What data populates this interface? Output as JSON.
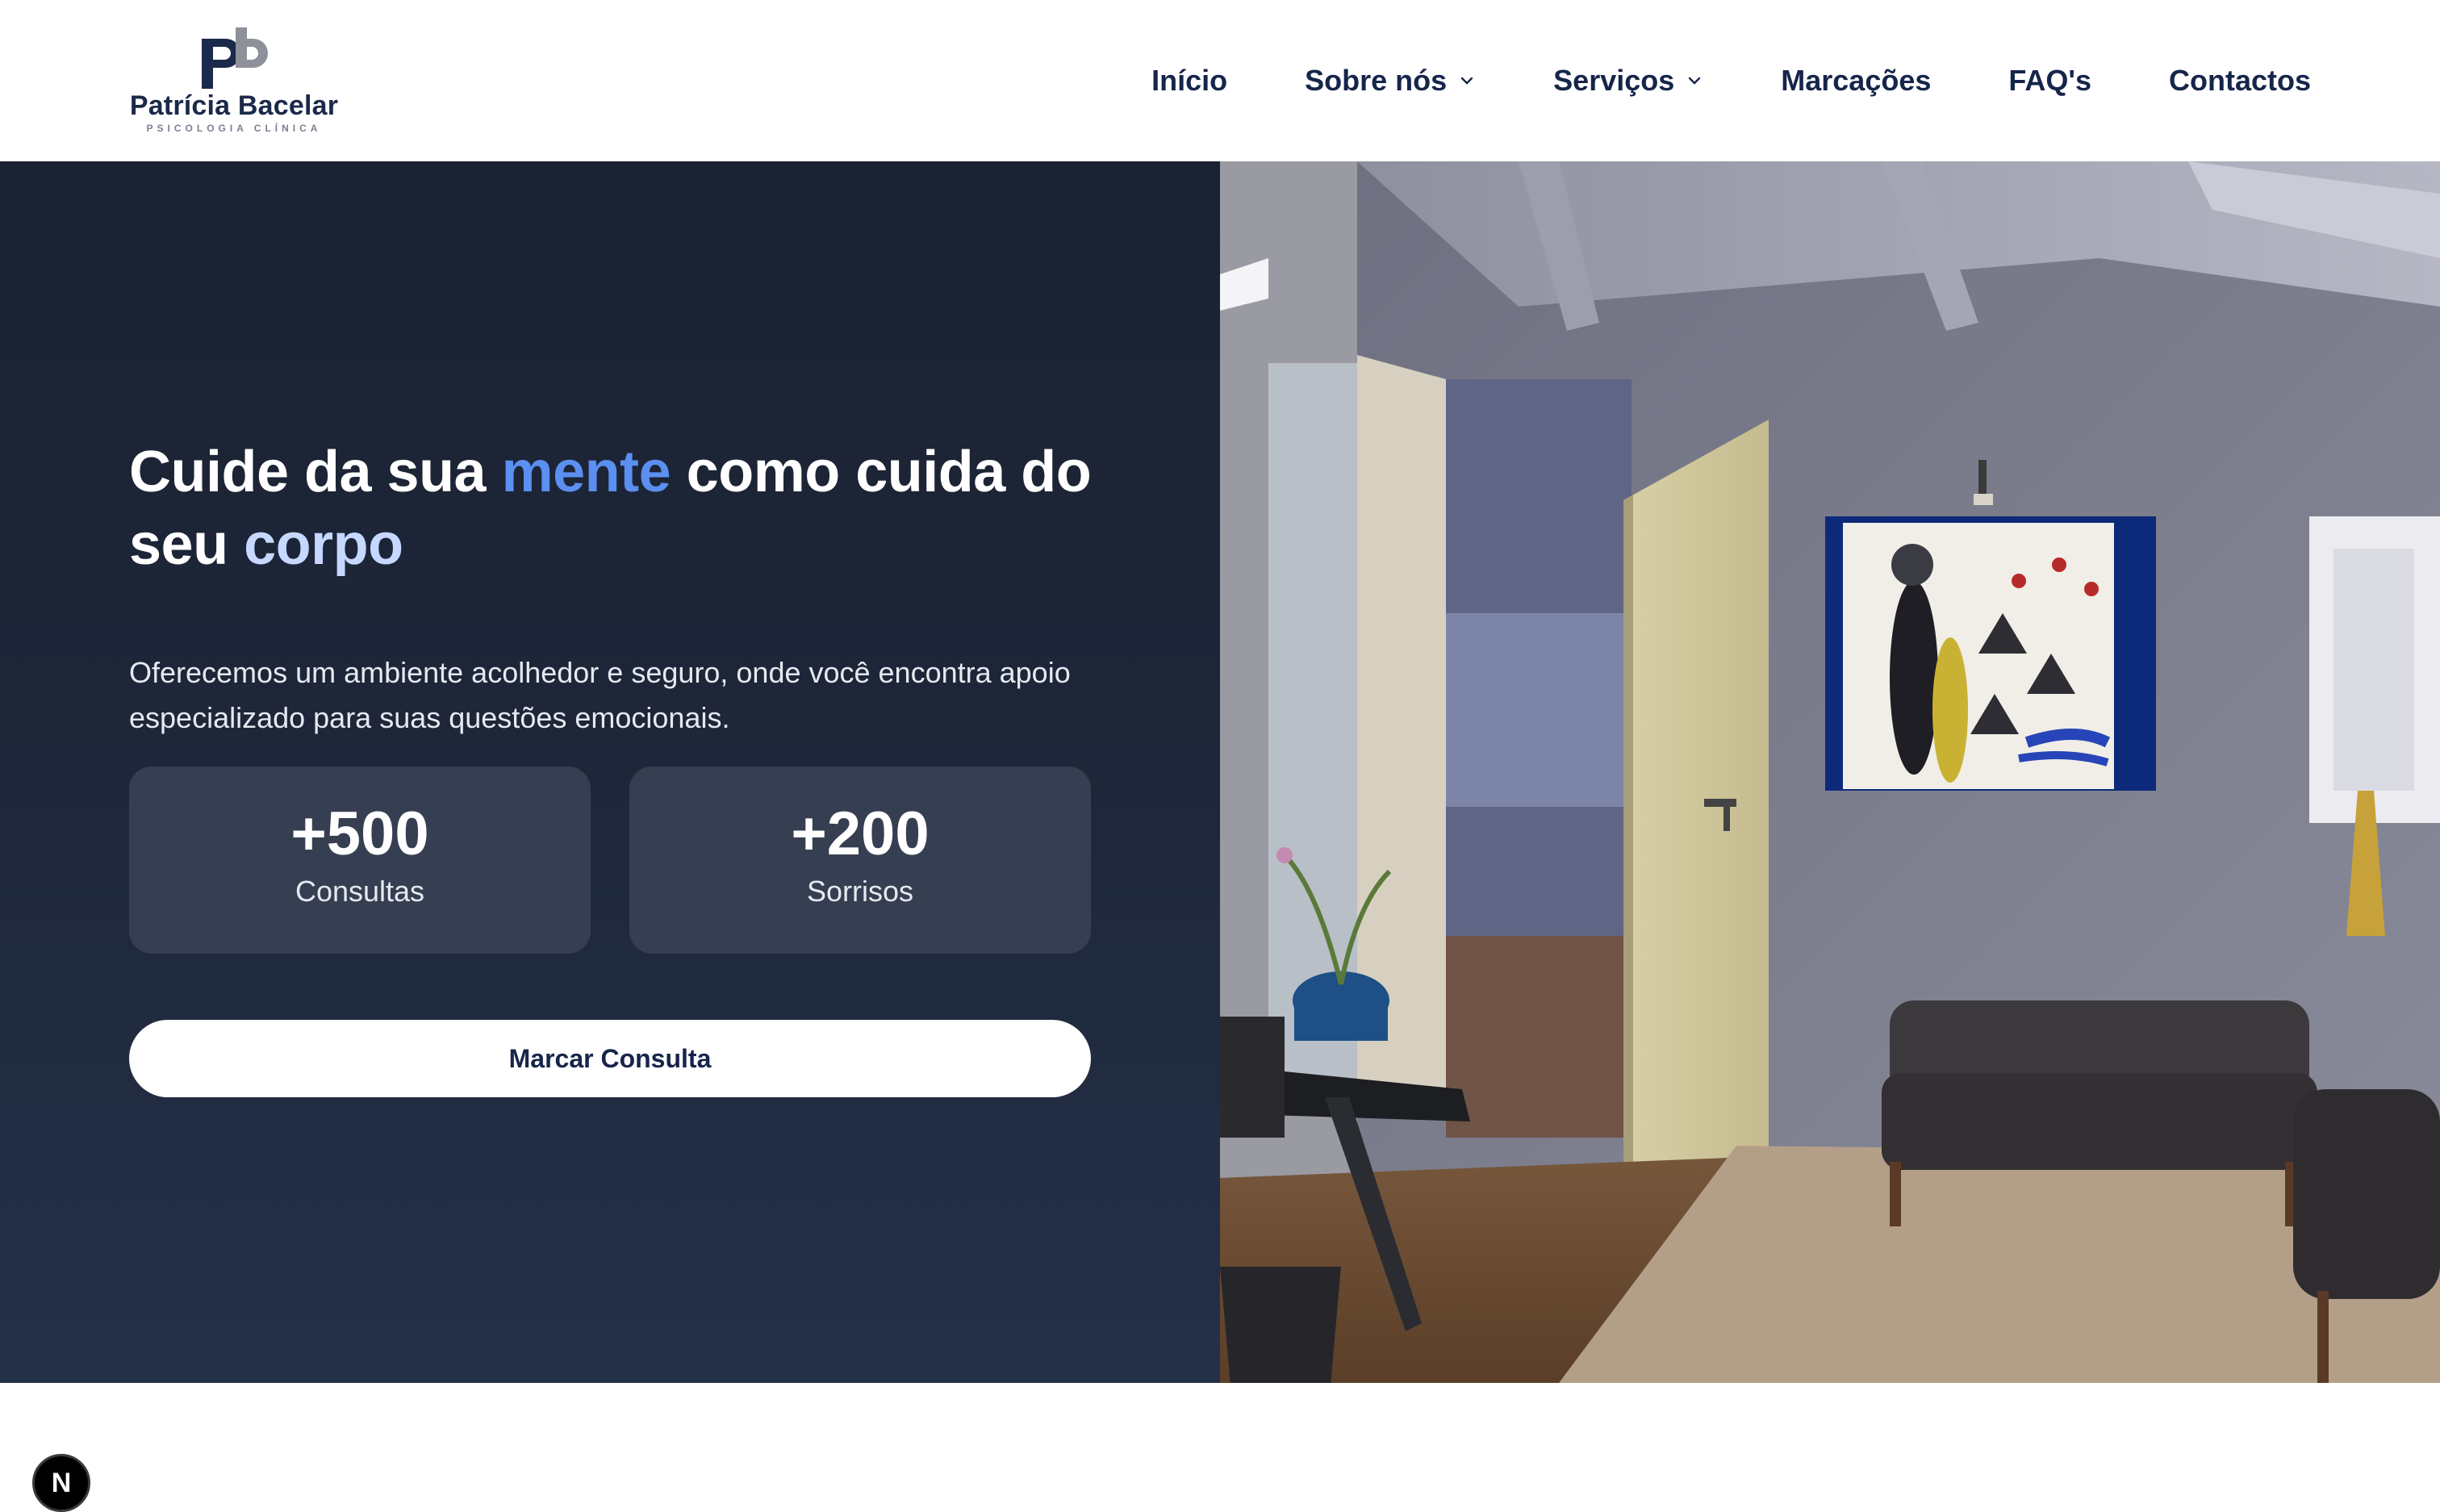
{
  "brand": {
    "monogram": "pb",
    "name": "Patrícia Bacelar",
    "tagline": "PSICOLOGIA CLÍNICA"
  },
  "nav": {
    "items": [
      {
        "label": "Início",
        "has_dropdown": false
      },
      {
        "label": "Sobre nós",
        "has_dropdown": true
      },
      {
        "label": "Serviços",
        "has_dropdown": true
      },
      {
        "label": "Marcações",
        "has_dropdown": false
      },
      {
        "label": "FAQ's",
        "has_dropdown": false
      },
      {
        "label": "Contactos",
        "has_dropdown": false
      }
    ]
  },
  "hero": {
    "headline_part1": "Cuide da sua ",
    "headline_highlight1": "mente",
    "headline_part2": " como cuida do seu ",
    "headline_highlight2": "corpo",
    "subtitle": "Oferecemos um ambiente acolhedor e seguro, onde você encontra apoio especializado para suas questões emocionais.",
    "stats": [
      {
        "value": "+500",
        "label": "Consultas"
      },
      {
        "value": "+200",
        "label": "Sorrisos"
      }
    ],
    "cta_label": "Marcar Consulta"
  },
  "dev_badge": {
    "label": "N"
  },
  "colors": {
    "primary_navy": "#16254a",
    "hero_bg": "#1e2739",
    "accent_blue": "#5b8ff0",
    "accent_light": "#c6d8ff",
    "card_bg": "#363e51"
  }
}
